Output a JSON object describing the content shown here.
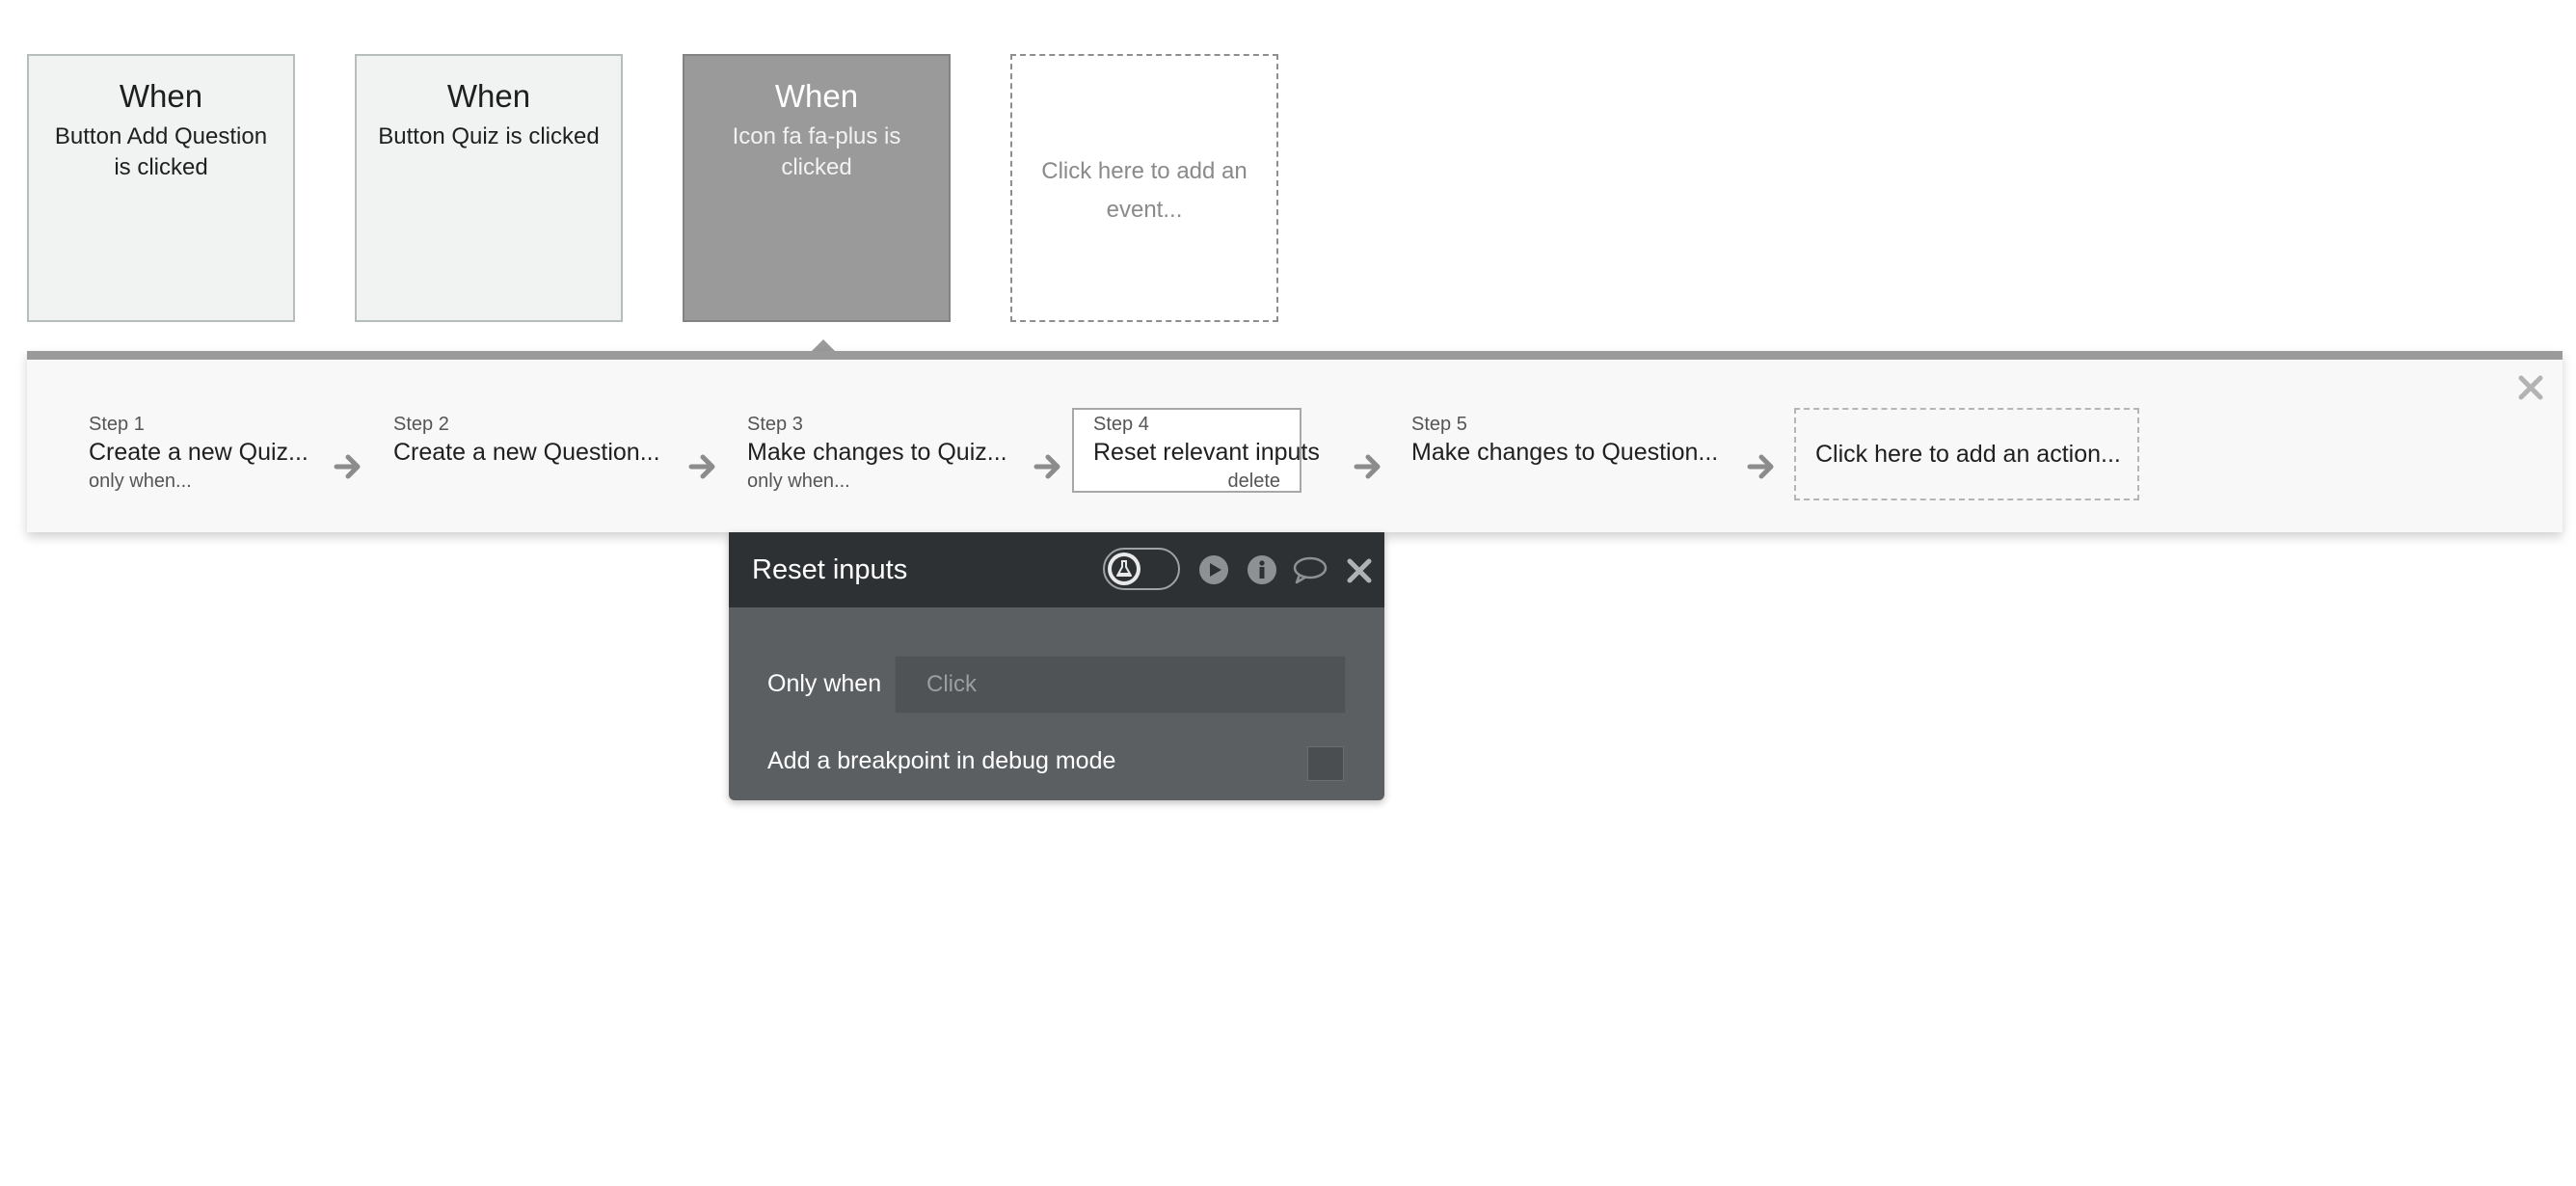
{
  "events": [
    {
      "when": "When",
      "description": "Button Add Question is clicked",
      "state": "normal"
    },
    {
      "when": "When",
      "description": "Button Quiz is clicked",
      "state": "normal"
    },
    {
      "when": "When",
      "description": "Icon fa fa-plus is clicked",
      "state": "selected"
    }
  ],
  "add_event_label": "Click here to add an event...",
  "steps": [
    {
      "number": "Step 1",
      "title": "Create a new Quiz...",
      "sub": "only when..."
    },
    {
      "number": "Step 2",
      "title": "Create a new Question...",
      "sub": ""
    },
    {
      "number": "Step 3",
      "title": "Make changes to Quiz...",
      "sub": "only when..."
    },
    {
      "number": "Step 4",
      "title": "Reset relevant inputs",
      "sub": "delete"
    },
    {
      "number": "Step 5",
      "title": "Make changes to Question...",
      "sub": ""
    }
  ],
  "add_action_label": "Click here to add an action...",
  "panel": {
    "title": "Reset inputs",
    "only_when_label": "Only when",
    "only_when_placeholder": "Click",
    "breakpoint_label": "Add a breakpoint in debug mode",
    "breakpoint_checked": false
  },
  "colors": {
    "selected_card": "#9a9a9a",
    "panel_header": "#2d3133",
    "panel_body": "#5b5f62",
    "arrow": "#8c8c8c"
  },
  "icons": {
    "toggle": "flask-icon",
    "run": "play-icon",
    "info": "info-icon",
    "comment": "comment-icon",
    "close": "close-icon",
    "arrow": "arrow-right-icon"
  }
}
